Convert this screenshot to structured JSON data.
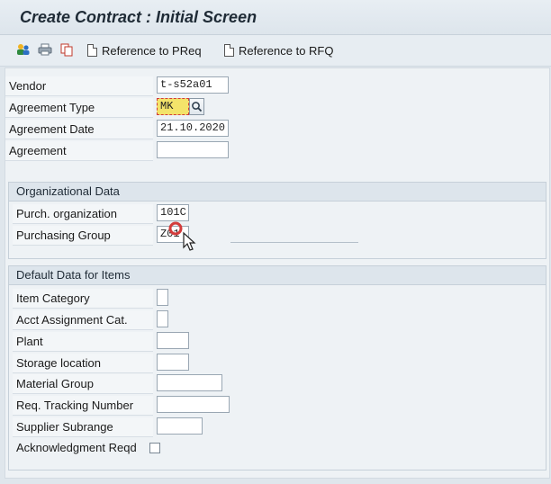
{
  "window": {
    "title": "Create Contract : Initial Screen"
  },
  "toolbar": {
    "icons": [
      "people-icon",
      "print-icon",
      "copy-icon"
    ],
    "ref_preq": "Reference to PReq",
    "ref_rfq": "Reference to RFQ"
  },
  "header_fields": {
    "vendor": {
      "label": "Vendor",
      "value": "t-s52a01"
    },
    "agreement_type": {
      "label": "Agreement Type",
      "value": "MK"
    },
    "agreement_date": {
      "label": "Agreement Date",
      "value": "21.10.2020"
    },
    "agreement": {
      "label": "Agreement",
      "value": ""
    }
  },
  "org_data": {
    "title": "Organizational Data",
    "purch_org": {
      "label": "Purch. organization",
      "value": "101C"
    },
    "purch_group": {
      "label": "Purchasing Group",
      "value": "Z01"
    }
  },
  "default_items": {
    "title": "Default Data for Items",
    "item_category": {
      "label": "Item Category",
      "value": ""
    },
    "acct_assignment": {
      "label": "Acct Assignment Cat.",
      "value": ""
    },
    "plant": {
      "label": "Plant",
      "value": ""
    },
    "storage_location": {
      "label": "Storage location",
      "value": ""
    },
    "material_group": {
      "label": "Material Group",
      "value": ""
    },
    "req_tracking": {
      "label": "Req. Tracking Number",
      "value": ""
    },
    "supplier_subrange": {
      "label": "Supplier Subrange",
      "value": ""
    },
    "ack_reqd": {
      "label": "Acknowledgment Reqd",
      "checked": false
    }
  },
  "colors": {
    "focus_highlight": "#f3e36a",
    "cursor_ring": "#d23b3b"
  }
}
